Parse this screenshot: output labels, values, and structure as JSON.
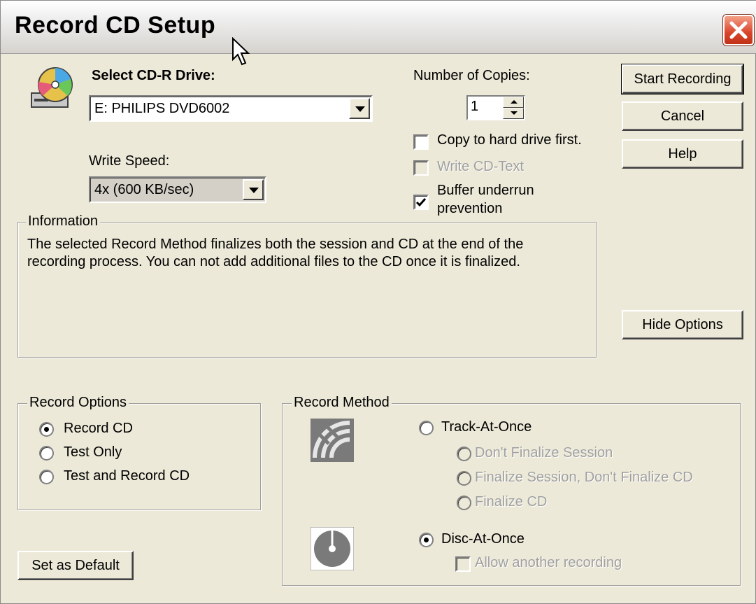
{
  "window": {
    "title": "Record CD Setup"
  },
  "drive": {
    "label": "Select CD-R Drive:",
    "selected": "E: PHILIPS DVD6002"
  },
  "speed": {
    "label": "Write Speed:",
    "selected": "4x (600 KB/sec)"
  },
  "copies": {
    "label": "Number of Copies:",
    "value": "1"
  },
  "checkboxes": {
    "copy_hd": {
      "label": "Copy to hard drive first.",
      "checked": false
    },
    "cd_text": {
      "label": "Write CD-Text",
      "checked": false,
      "disabled": true
    },
    "buffer": {
      "label_line1": "Buffer underrun",
      "label_line2": "prevention",
      "checked": true
    }
  },
  "buttons": {
    "start": "Start Recording",
    "cancel": "Cancel",
    "help": "Help",
    "hide_options": "Hide Options",
    "set_default": "Set as Default"
  },
  "information": {
    "label": "Information",
    "line1": "The selected Record Method finalizes both the session and CD at the end of the",
    "line2": "recording process. You can not add additional files to the CD once it is finalized."
  },
  "record_options": {
    "label": "Record Options",
    "items": [
      {
        "label": "Record CD",
        "selected": true
      },
      {
        "label": "Test Only",
        "selected": false
      },
      {
        "label": "Test and Record CD",
        "selected": false
      }
    ]
  },
  "record_method": {
    "label": "Record Method",
    "track_at_once": "Track-At-Once",
    "tao_options": [
      "Don't Finalize Session",
      "Finalize Session, Don't Finalize CD",
      "Finalize CD"
    ],
    "disc_at_once": "Disc-At-Once",
    "allow_another": "Allow another recording"
  },
  "colors": {
    "dialog_bg": "#ece9d8",
    "close_red": "#d9442a",
    "disabled_text": "#a0a0a0"
  }
}
